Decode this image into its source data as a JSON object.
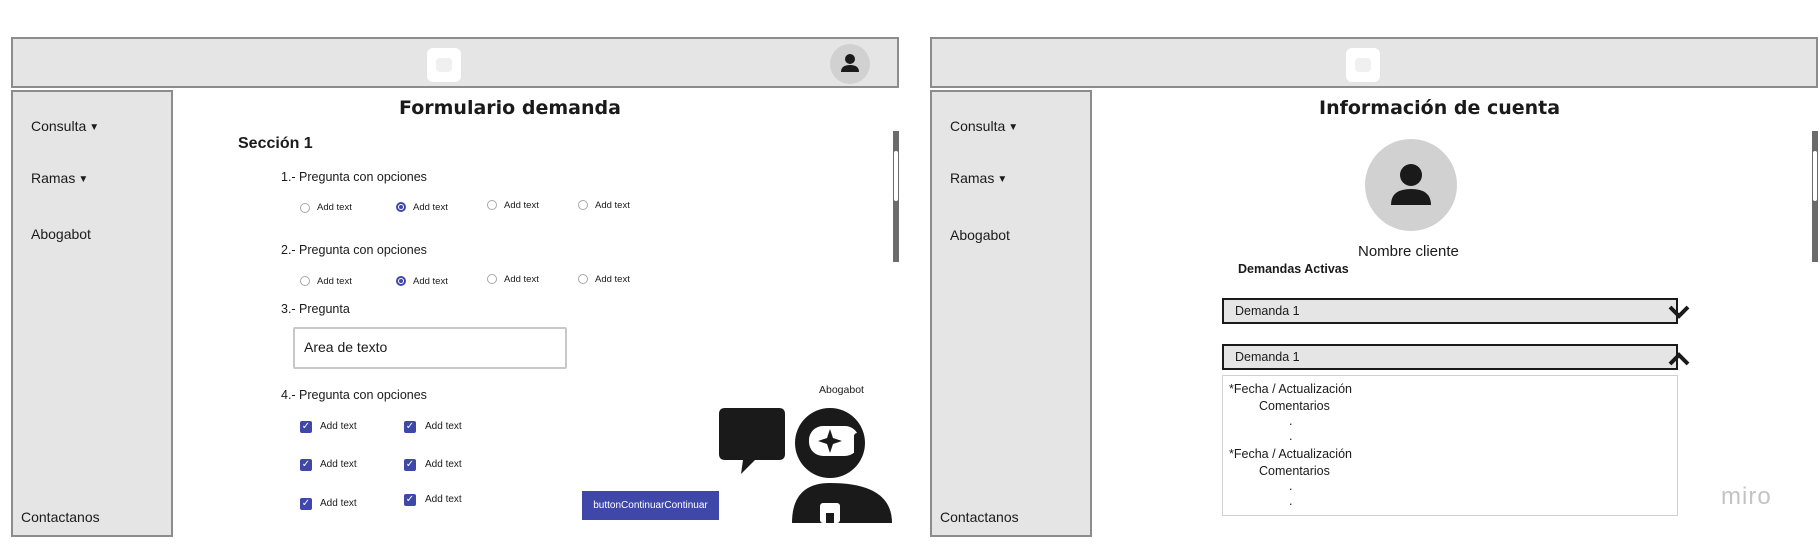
{
  "left_screen": {
    "sidebar": {
      "items": [
        {
          "label": "Consulta",
          "chevron": "chevron-down-icon"
        },
        {
          "label": "Ramas",
          "chevron": "chevron-down-icon"
        },
        {
          "label": "Abogabot"
        }
      ],
      "footer_link": "Contactanos"
    },
    "title": "Formulario demanda",
    "section_title": "Sección 1",
    "questions": [
      {
        "label": "1.- Pregunta con opciones",
        "options": [
          "Add text",
          "Add text",
          "Add text",
          "Add text"
        ],
        "selected_index": 1
      },
      {
        "label": "2.- Pregunta con opciones",
        "options": [
          "Add text",
          "Add text",
          "Add text",
          "Add text"
        ],
        "selected_index": 1
      },
      {
        "label": "3.- Pregunta",
        "textarea_value": "Area de texto"
      },
      {
        "label": "4.- Pregunta con opciones",
        "checkboxes": [
          "Add text",
          "Add text",
          "Add text",
          "Add text",
          "Add text",
          "Add text"
        ],
        "checked": [
          true,
          true,
          true,
          true,
          true,
          true
        ]
      }
    ],
    "continue_button": "buttonContinuarContinuar",
    "chatbot": {
      "label": "Abogabot",
      "icon": "astronaut-icon",
      "bubble_icon": "chat-bubble-icon"
    }
  },
  "right_screen": {
    "sidebar": {
      "items": [
        {
          "label": "Consulta",
          "chevron": "chevron-down-icon"
        },
        {
          "label": "Ramas",
          "chevron": "chevron-down-icon"
        },
        {
          "label": "Abogabot"
        }
      ],
      "footer_link": "Contactanos"
    },
    "title": "Información de cuenta",
    "client_name": "Nombre cliente",
    "active_demands_label": "Demandas Activas",
    "demands": [
      {
        "label": "Demanda 1",
        "expanded": false
      },
      {
        "label": "Demanda 1",
        "expanded": true
      }
    ],
    "details": {
      "entries": [
        {
          "date": "*Fecha / Actualización",
          "comments": "Comentarios",
          "dots": [
            ".",
            "."
          ]
        },
        {
          "date": "*Fecha / Actualización",
          "comments": "Comentarios",
          "dots": [
            ".",
            "."
          ]
        }
      ]
    }
  },
  "watermark": "miro",
  "colors": {
    "accent": "#3f48a8",
    "panel_gray": "#e5e5e5",
    "border_gray": "#8c8c8c"
  }
}
